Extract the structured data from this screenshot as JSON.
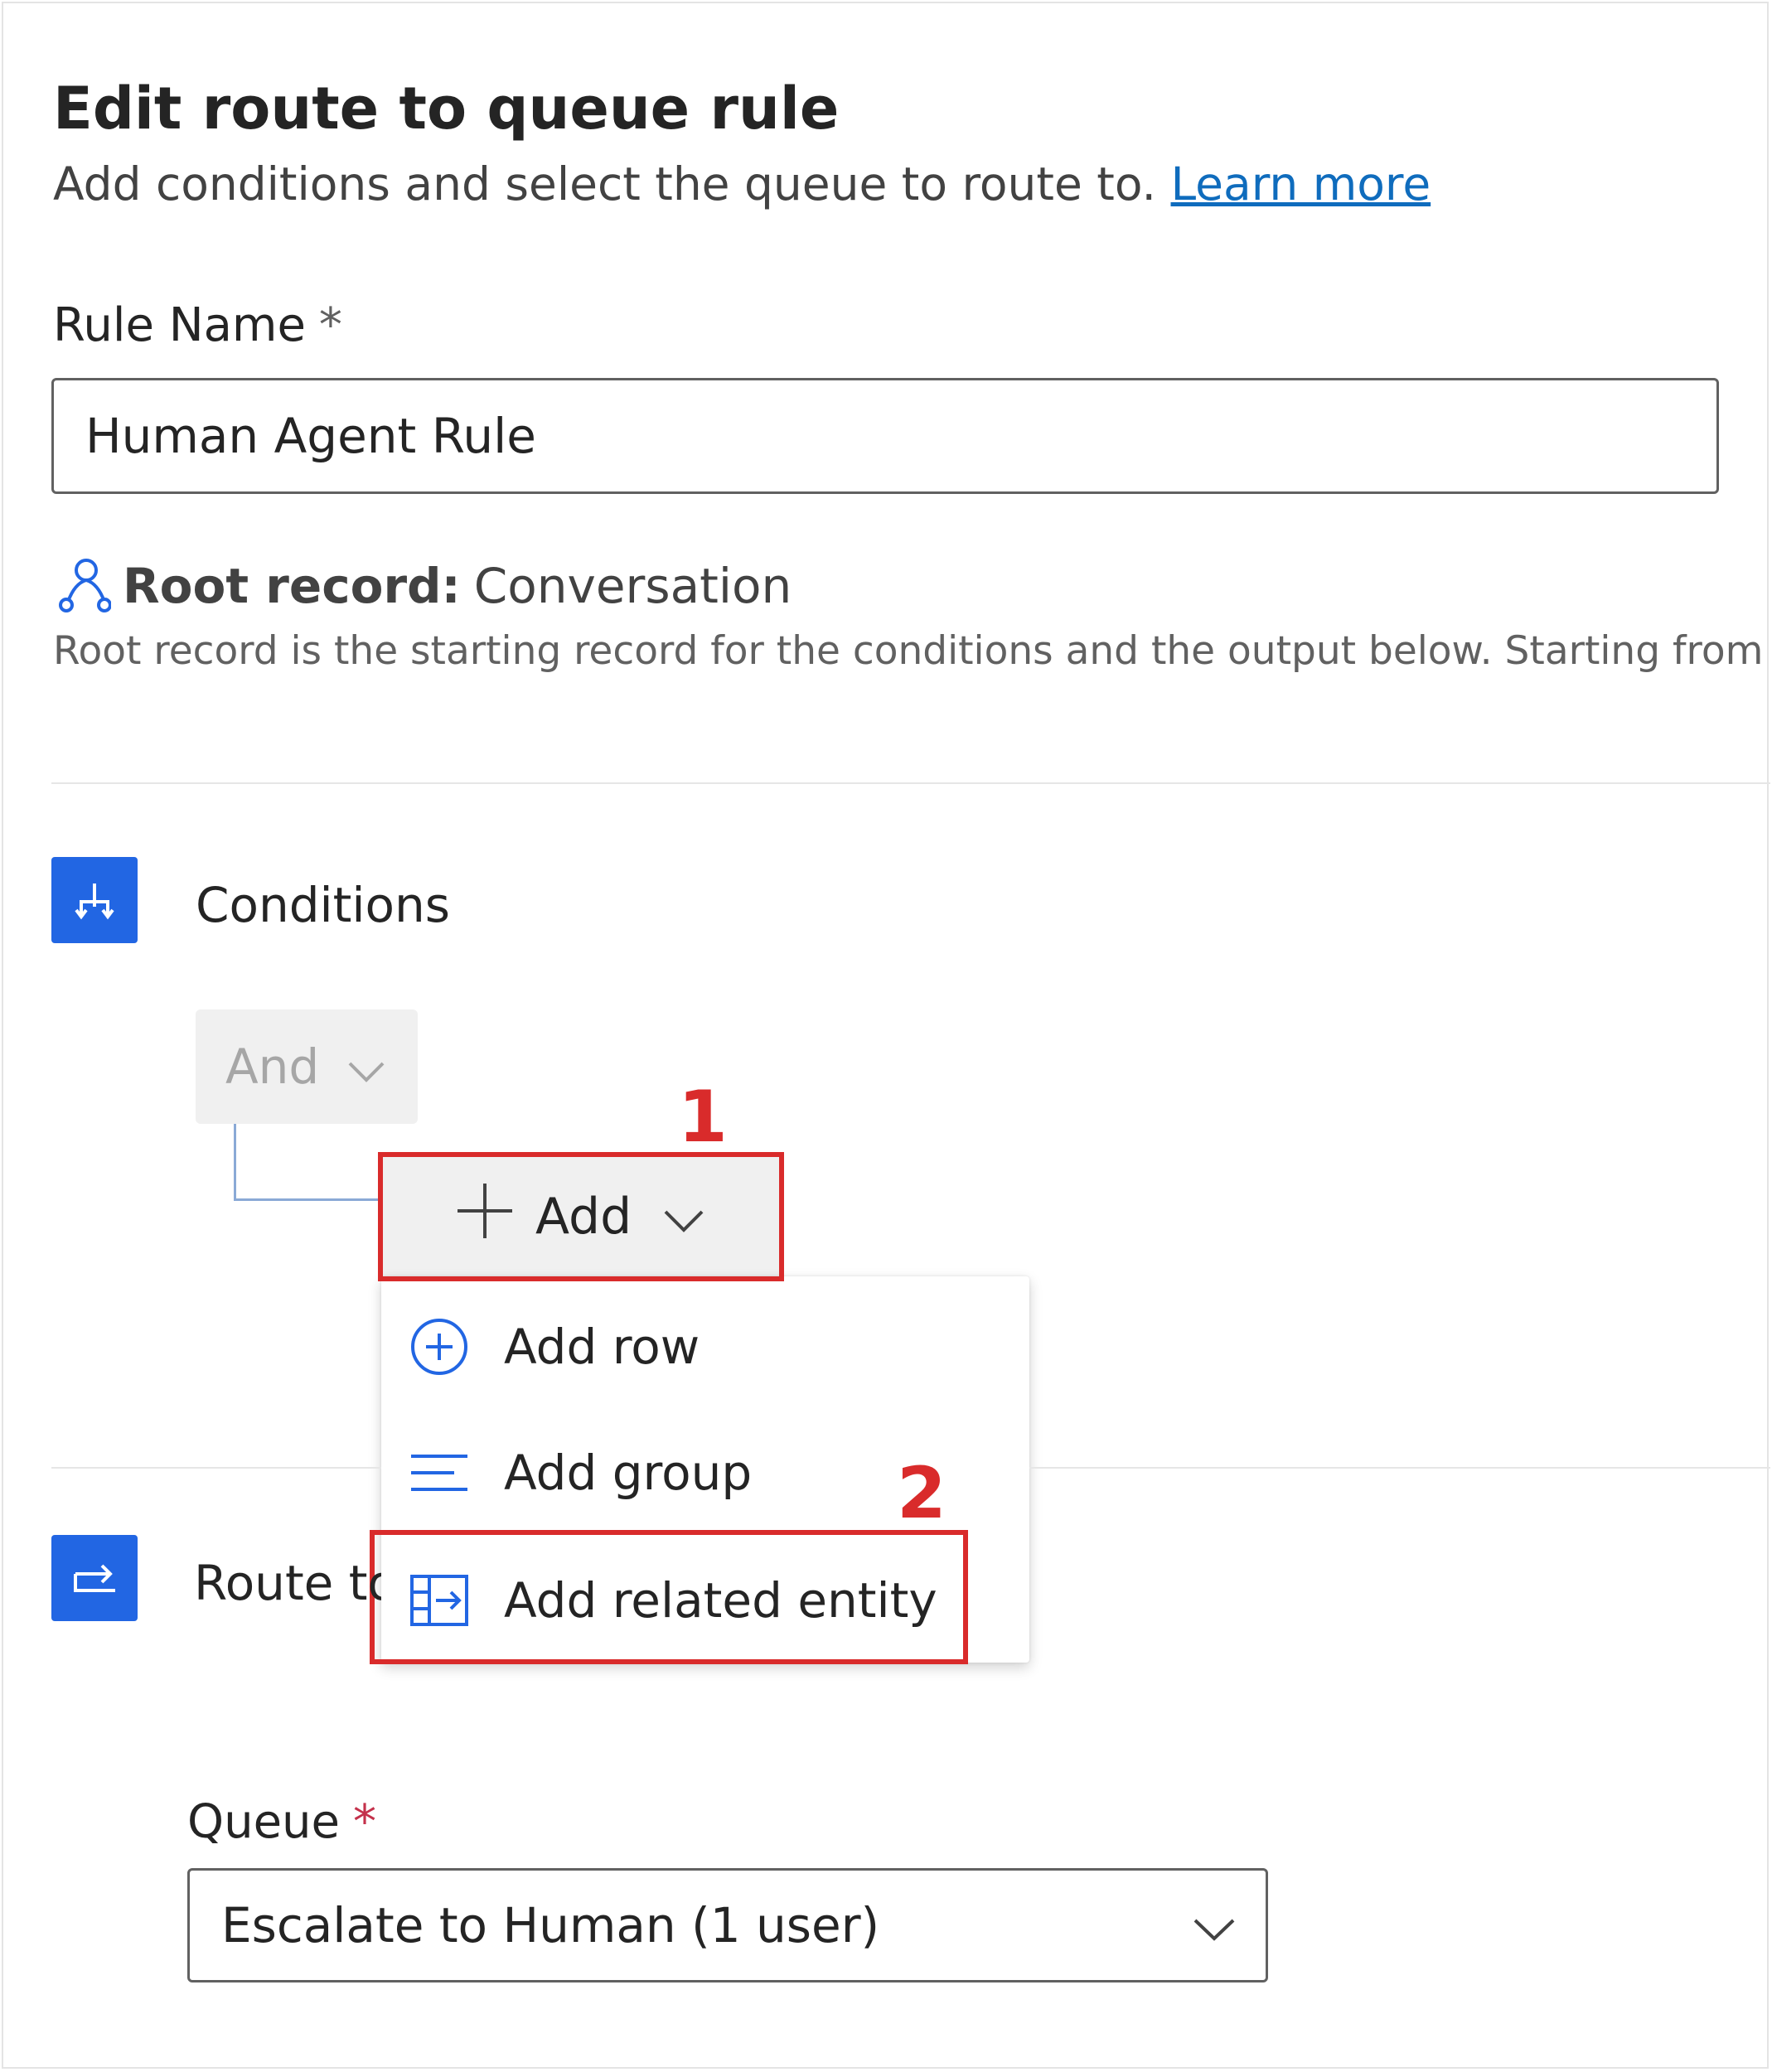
{
  "header": {
    "title": "Edit route to queue rule",
    "subtitle": "Add conditions and select the queue to route to.",
    "learn_more": "Learn more"
  },
  "rule_name": {
    "label": "Rule Name",
    "required_mark": "*",
    "value": "Human Agent Rule"
  },
  "root_record": {
    "label": "Root record:",
    "value": "Conversation",
    "description": "Root record is the starting record for the conditions and the output below. Starting from th"
  },
  "conditions": {
    "title": "Conditions",
    "operator": "And",
    "add_label": "Add",
    "menu": [
      {
        "label": "Add row",
        "icon": "add-circle-icon"
      },
      {
        "label": "Add group",
        "icon": "text-lines-icon"
      },
      {
        "label": "Add related entity",
        "icon": "table-arrow-icon"
      }
    ]
  },
  "annotations": {
    "step1": "1",
    "step2": "2",
    "color": "#d92b2b"
  },
  "route_to": {
    "title": "Route to"
  },
  "queue": {
    "label": "Queue",
    "required_mark": "*",
    "value": "Escalate to Human (1 user)"
  },
  "colors": {
    "accent": "#2266e3",
    "link": "#0f6cbd",
    "annotation_red": "#d92b2b"
  }
}
